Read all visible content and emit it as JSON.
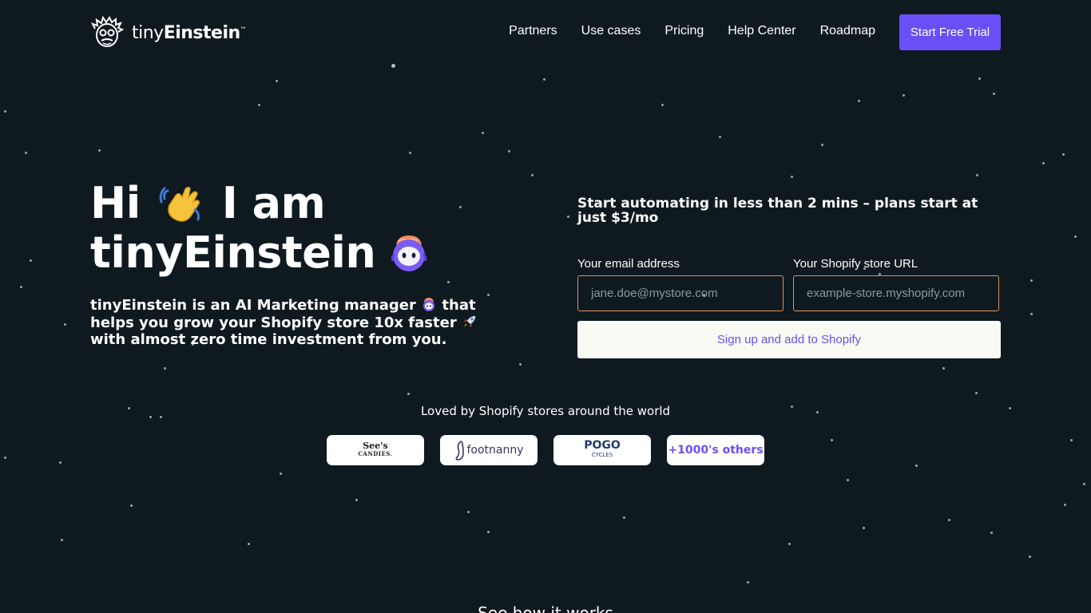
{
  "brand": {
    "name_light": "tiny",
    "name_bold": "Einstein",
    "trademark": "™"
  },
  "nav": {
    "links": [
      "Partners",
      "Use cases",
      "Pricing",
      "Help Center",
      "Roadmap"
    ],
    "cta": "Start Free Trial"
  },
  "hero": {
    "title_line1_a": "Hi",
    "title_line1_b": "I am",
    "title_line2": "tinyEinstein",
    "desc_part1": "tinyEinstein is an AI Marketing manager",
    "desc_part2": "that helps you grow your Shopify store 10x faster",
    "desc_part3": "with almost zero time investment from you."
  },
  "form": {
    "title": "Start automating in less than 2 mins – plans start at just $3/mo",
    "email_label": "Your email address",
    "email_placeholder": "jane.doe@mystore.com",
    "url_label": "Your Shopify store URL",
    "url_placeholder": "example-store.myshopify.com",
    "submit": "Sign up and add to Shopify"
  },
  "social_proof": {
    "heading": "Loved by Shopify stores around the world",
    "brands": {
      "sees_top": "See's",
      "sees_bottom": "CANDIES.",
      "footnanny": "footnanny",
      "pogo_top": "POGO",
      "pogo_bottom": "CYCLES",
      "others": "+1000's others"
    }
  },
  "next_section": {
    "heading": "See how it works"
  },
  "colors": {
    "background": "#0f1a20",
    "accent": "#6b4ff6",
    "input_border": "#e58d5c",
    "button_light": "#f8faf3"
  }
}
